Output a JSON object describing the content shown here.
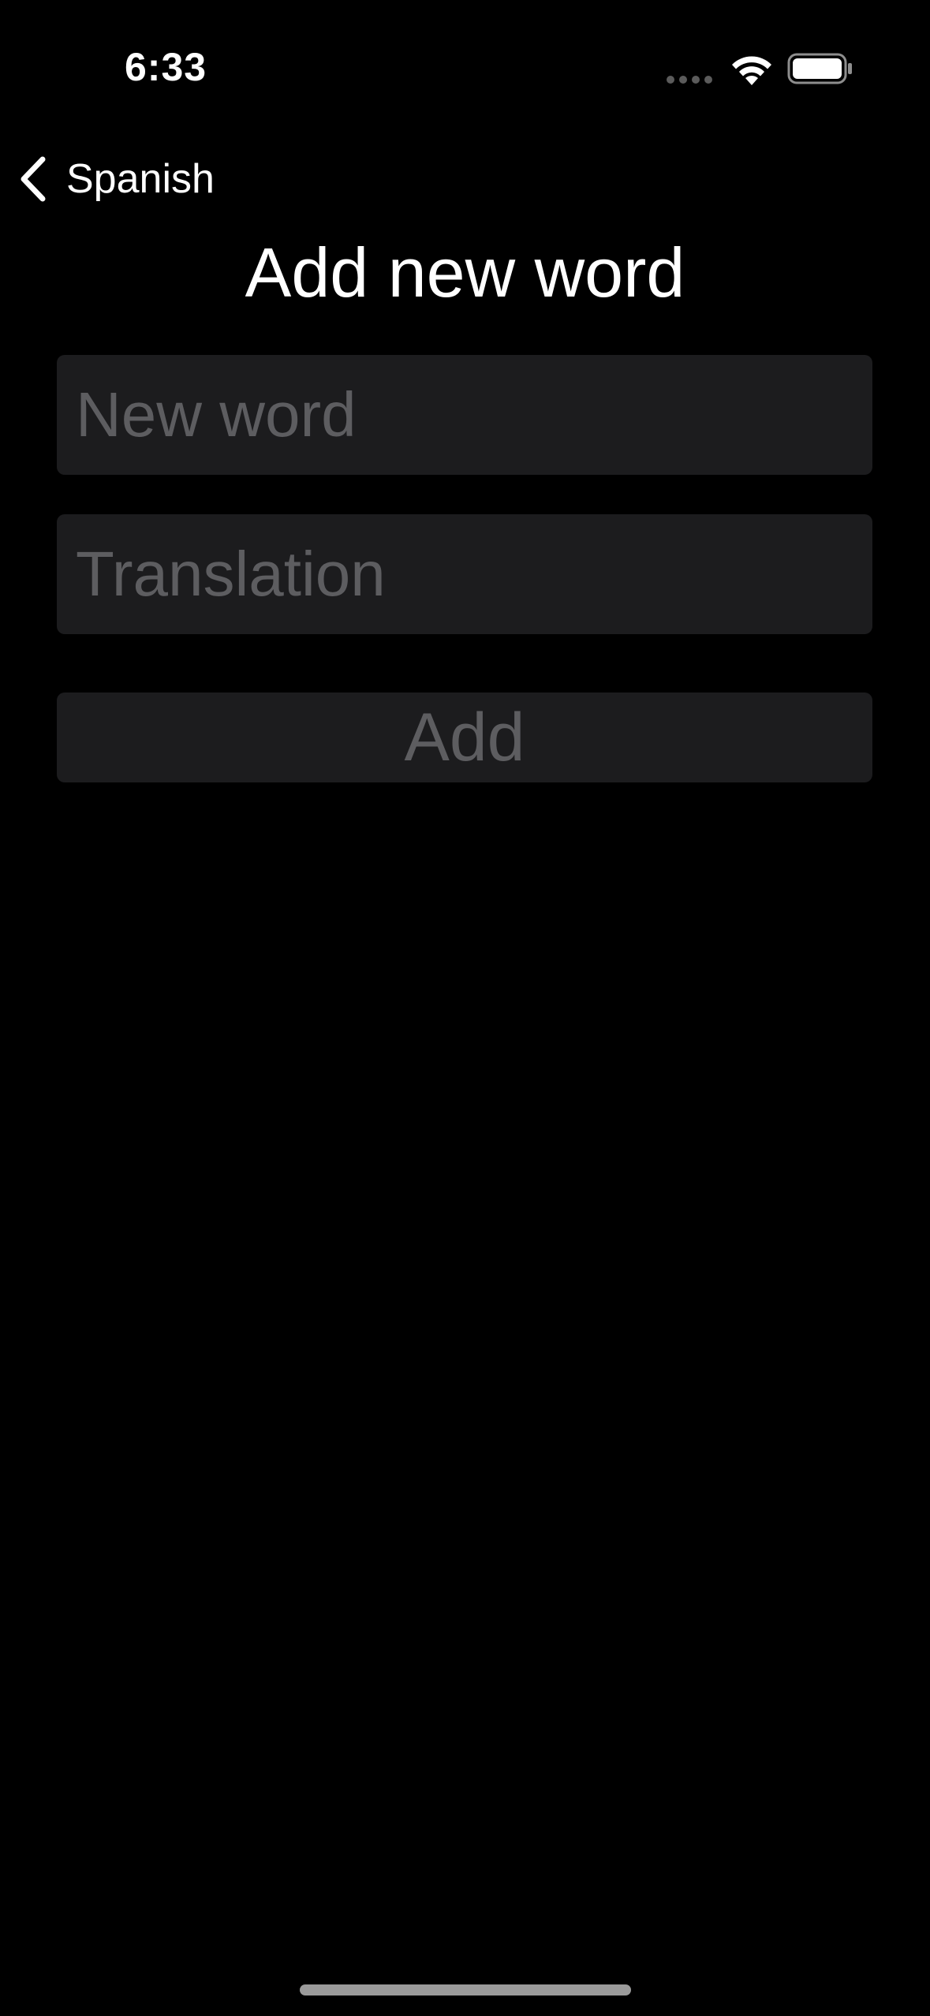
{
  "status_bar": {
    "time": "6:33",
    "icons": [
      "cellular-signal-icon",
      "wifi-icon",
      "battery-icon"
    ]
  },
  "nav": {
    "back_label": "Spanish",
    "back_icon": "chevron-left-icon"
  },
  "page": {
    "title": "Add new word"
  },
  "form": {
    "word_placeholder": "New word",
    "word_value": "",
    "translation_placeholder": "Translation",
    "translation_value": "",
    "add_label": "Add"
  },
  "colors": {
    "background": "#000000",
    "field_background": "#1c1c1e",
    "placeholder_text": "#5d5d60",
    "primary_text": "#ffffff"
  }
}
